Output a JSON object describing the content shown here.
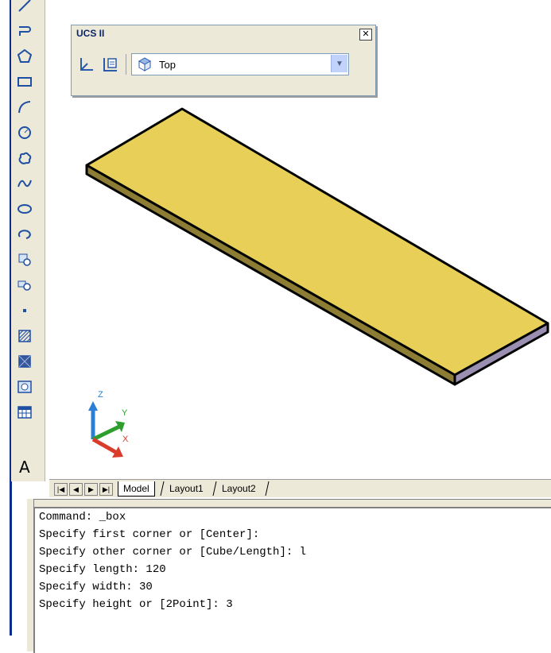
{
  "ucs_toolbar": {
    "title": "UCS II",
    "close_glyph": "✕",
    "selected_view": "Top"
  },
  "draw_toolbar": {
    "tools": [
      "line-icon",
      "polyline-icon",
      "polygon-icon",
      "rectangle-icon",
      "arc-icon",
      "circle-icon",
      "revision-cloud-icon",
      "spline-icon",
      "ellipse-icon",
      "ellipse-arc-icon",
      "insert-block-icon",
      "make-block-icon",
      "point-icon",
      "hatch-icon",
      "gradient-icon",
      "region-icon",
      "table-icon"
    ],
    "text_tool_label": "A"
  },
  "viewport": {
    "object": "box",
    "top_color": "#e7cf58",
    "side_color": "#8d7d34",
    "end_color": "#9a8fb0",
    "ucs_labels": {
      "x": "X",
      "y": "Y",
      "z": "Z"
    }
  },
  "layout_tabs": {
    "nav": [
      "|◀",
      "◀",
      "▶",
      "▶|"
    ],
    "tabs": [
      "Model",
      "Layout1",
      "Layout2"
    ],
    "active": "Model"
  },
  "command_window": {
    "lines": [
      "Command: _box",
      "Specify first corner or [Center]:",
      "Specify other corner or [Cube/Length]: l",
      "Specify length: 120",
      "Specify width: 30",
      "Specify height or [2Point]: 3"
    ]
  }
}
